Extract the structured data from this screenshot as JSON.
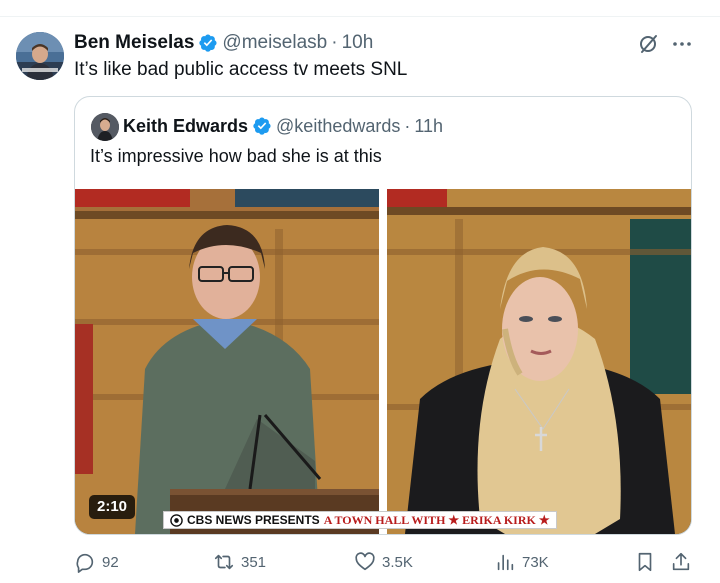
{
  "tweet": {
    "author_name": "Ben Meiselas",
    "handle": "@meiselasb",
    "separator": "·",
    "time": "10h",
    "text": "It’s like bad public access tv meets SNL"
  },
  "quoted": {
    "author_name": "Keith Edwards",
    "handle": "@keithedwards",
    "separator": "·",
    "time": "11h",
    "text": "It’s impressive how bad she is at this",
    "video": {
      "duration": "2:10",
      "chyron_network": "CBS NEWS PRESENTS",
      "chyron_show": "A TOWN HALL WITH ★ ERIKA KIRK ★"
    }
  },
  "actions": {
    "replies": "92",
    "reposts": "351",
    "likes": "3.5K",
    "views": "73K"
  },
  "icons": {
    "verified": "verified-badge-icon",
    "grok": "grok-icon",
    "more": "more-icon",
    "reply": "reply-icon",
    "repost": "repost-icon",
    "like": "like-icon",
    "views": "views-icon",
    "bookmark": "bookmark-icon",
    "share": "share-icon"
  },
  "colors": {
    "verified_blue": "#1d9bf0",
    "secondary_text": "#536471",
    "border": "#cfd9de",
    "chyron_red": "#b81c1c"
  }
}
